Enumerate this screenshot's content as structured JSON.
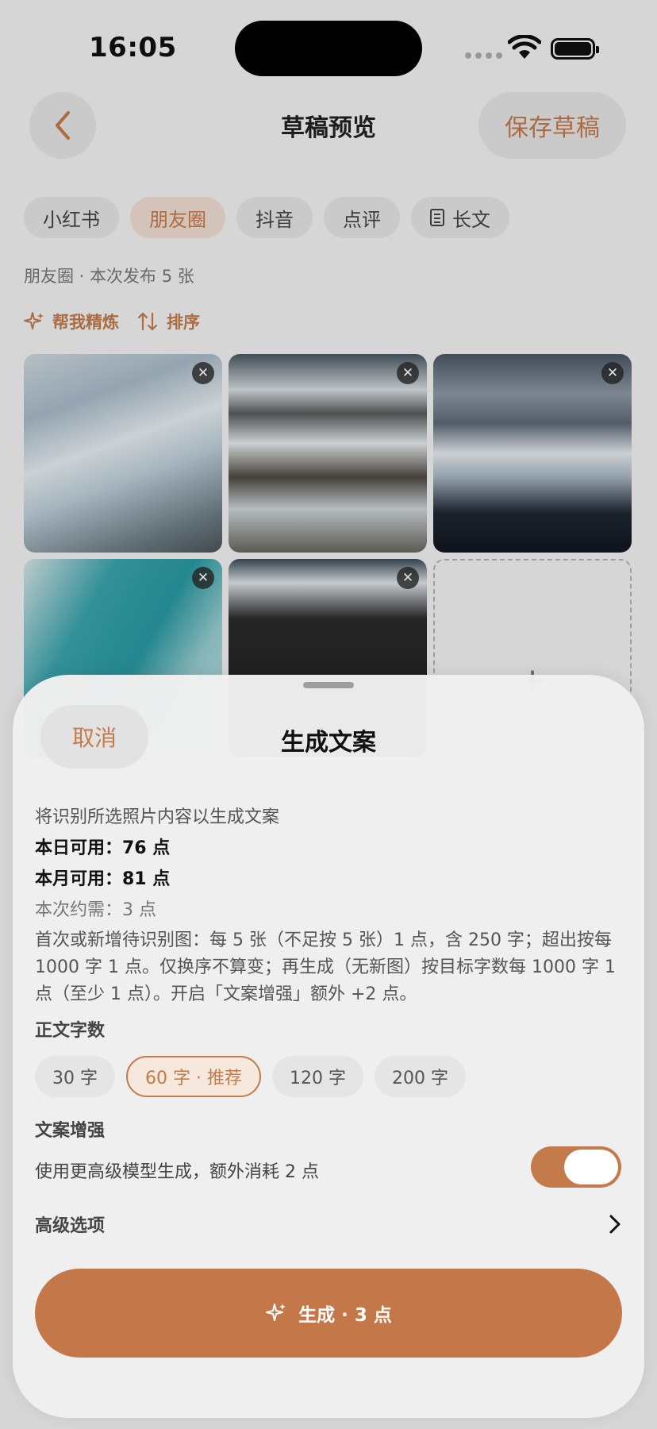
{
  "status_bar": {
    "time": "16:05"
  },
  "header": {
    "title": "草稿预览",
    "save_label": "保存草稿"
  },
  "platform_tabs": [
    {
      "label": "小红书",
      "active": false
    },
    {
      "label": "朋友圈",
      "active": true
    },
    {
      "label": "抖音",
      "active": false
    },
    {
      "label": "点评",
      "active": false
    },
    {
      "label": "长文",
      "active": false,
      "icon": "document-icon"
    }
  ],
  "publish_info": "朋友圈 · 本次发布 5 张",
  "actions": {
    "refine_label": "帮我精炼",
    "sort_label": "排序"
  },
  "photos": [
    {
      "desc": "glacier ice"
    },
    {
      "desc": "ice lagoon"
    },
    {
      "desc": "snow mountains"
    },
    {
      "desc": "turquoise ice"
    },
    {
      "desc": "reflection"
    }
  ],
  "add_photo_label": "+",
  "sheet": {
    "cancel_label": "取消",
    "title": "生成文案",
    "intro": "将识别所选照片内容以生成文案",
    "daily": "本日可用：76 点",
    "monthly": "本月可用：81 点",
    "cost": "本次约需：3 点",
    "rules": "首次或新增待识别图：每 5 张（不足按 5 张）1 点，含 250 字；超出按每 1000 字 1 点。仅换序不算变；再生成（无新图）按目标字数每 1000 字 1 点（至少 1 点）。开启「文案增强」额外 +2 点。",
    "word_count_label": "正文字数",
    "word_counts": [
      {
        "label": "30 字",
        "selected": false
      },
      {
        "label": "60 字 · 推荐",
        "selected": true
      },
      {
        "label": "120 字",
        "selected": false
      },
      {
        "label": "200 字",
        "selected": false
      }
    ],
    "enhance_label": "文案增强",
    "enhance_desc": "使用更高级模型生成，额外消耗 2 点",
    "enhance_on": true,
    "advanced_label": "高级选项",
    "generate_label": "生成 · 3 点"
  },
  "colors": {
    "accent": "#c47a4a",
    "accent_bg": "#f1dfd3"
  }
}
